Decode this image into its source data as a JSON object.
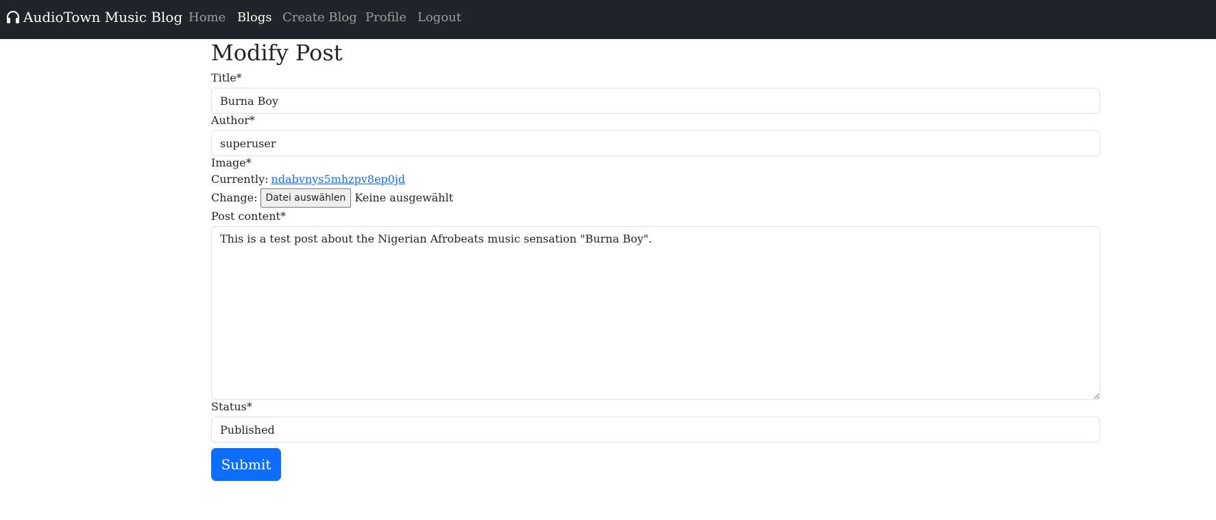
{
  "navbar": {
    "brand_label": "AudioTown Music Blog",
    "brand_icon": "headphones-icon",
    "links": [
      {
        "label": "Home",
        "active": false
      },
      {
        "label": "Blogs",
        "active": true
      },
      {
        "label": "Create Blog",
        "active": false
      },
      {
        "label": "Profile",
        "active": false
      },
      {
        "label": "Logout",
        "active": false
      }
    ],
    "colors": {
      "background": "#212529",
      "active_link": "#ffffff",
      "inactive_link": "rgba(255,255,255,0.55)"
    }
  },
  "form": {
    "heading": "Modify Post",
    "title_label": "Title*",
    "title_value": "Burna Boy",
    "author_label": "Author*",
    "author_value": "superuser",
    "image_label": "Image*",
    "image_current_prefix": "Currently:",
    "image_current_link": "ndabvnys5mhzpv8ep0jd",
    "image_change_prefix": "Change:",
    "file_button_label": "Datei auswählen",
    "file_status": "Keine ausgewählt",
    "content_label": "Post content*",
    "content_value": "This is a test post about the Nigerian Afrobeats music sensation \"Burna Boy\".",
    "status_label": "Status*",
    "status_value": "Published",
    "submit_label": "Submit"
  },
  "colors": {
    "primary": "#0d6efd",
    "link": "#0d6efd",
    "border": "#dee2e6"
  }
}
